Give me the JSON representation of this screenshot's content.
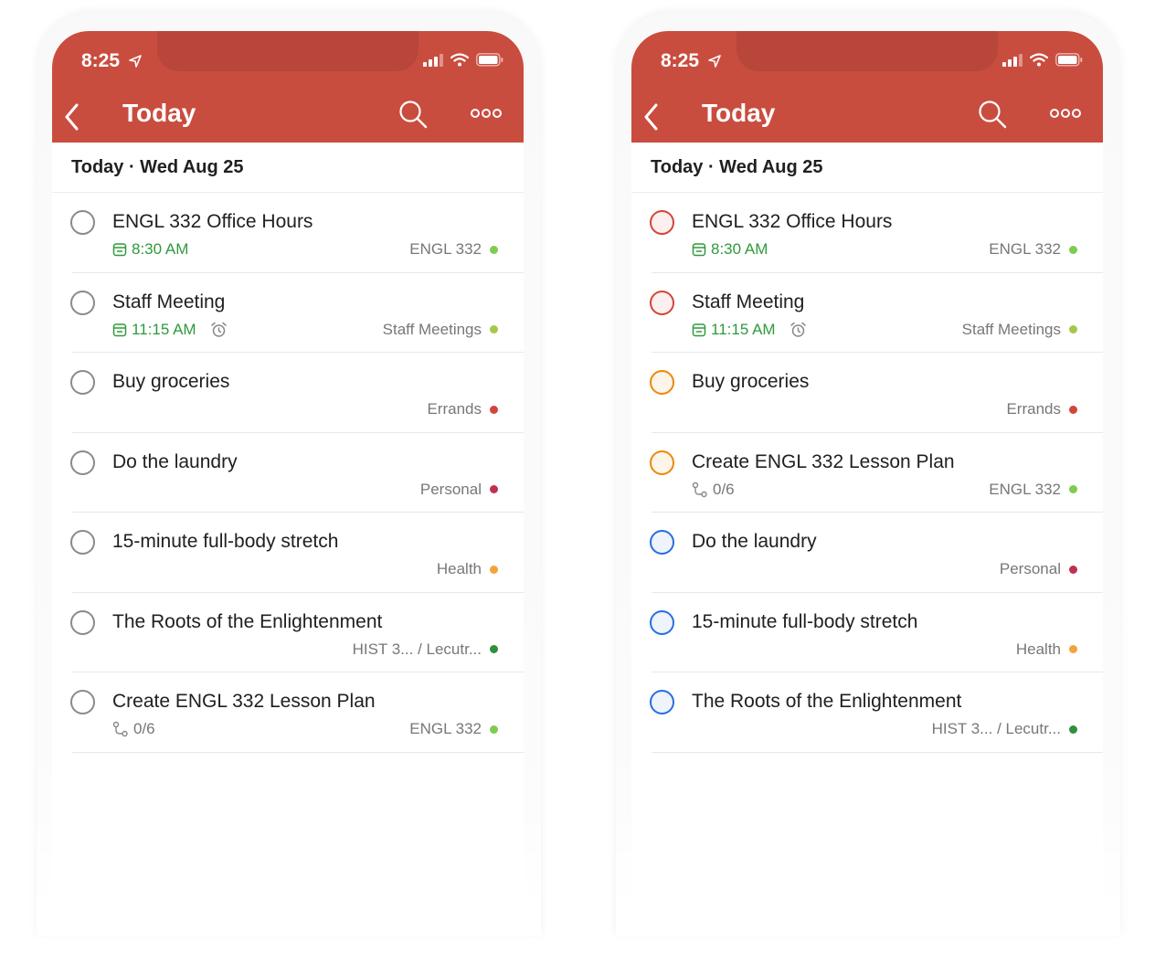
{
  "phones": [
    {
      "status_time": "8:25",
      "title": "Today",
      "date_label": "Today · Wed Aug 25",
      "tasks": [
        {
          "title": "ENGL 332 Office Hours",
          "meta_kind": "date",
          "meta": "8:30 AM",
          "alarm": false,
          "project": "ENGL 332",
          "project_color": "#7ecb4e",
          "check_color": "#8a8a8a",
          "check_fill": "#ffffff"
        },
        {
          "title": "Staff Meeting",
          "meta_kind": "date",
          "meta": "11:15 AM",
          "alarm": true,
          "project": "Staff Meetings",
          "project_color": "#a6c84a",
          "check_color": "#8a8a8a",
          "check_fill": "#ffffff"
        },
        {
          "title": "Buy groceries",
          "meta_kind": "none",
          "meta": "",
          "alarm": false,
          "project": "Errands",
          "project_color": "#d2453b",
          "check_color": "#8a8a8a",
          "check_fill": "#ffffff"
        },
        {
          "title": "Do the laundry",
          "meta_kind": "none",
          "meta": "",
          "alarm": false,
          "project": "Personal",
          "project_color": "#c0314f",
          "check_color": "#8a8a8a",
          "check_fill": "#ffffff"
        },
        {
          "title": "15-minute full-body stretch",
          "meta_kind": "none",
          "meta": "",
          "alarm": false,
          "project": "Health",
          "project_color": "#f2a33c",
          "check_color": "#8a8a8a",
          "check_fill": "#ffffff"
        },
        {
          "title": "The Roots of the Enlightenment",
          "meta_kind": "none",
          "meta": "",
          "alarm": false,
          "project": "HIST 3... / Lecutr...",
          "project_color": "#2f8f3a",
          "check_color": "#8a8a8a",
          "check_fill": "#ffffff"
        },
        {
          "title": "Create ENGL 332 Lesson Plan",
          "meta_kind": "subtask",
          "meta": "0/6",
          "alarm": false,
          "project": "ENGL 332",
          "project_color": "#7ecb4e",
          "check_color": "#8a8a8a",
          "check_fill": "#ffffff"
        }
      ]
    },
    {
      "status_time": "8:25",
      "title": "Today",
      "date_label": "Today · Wed Aug 25",
      "tasks": [
        {
          "title": "ENGL 332 Office Hours",
          "meta_kind": "date",
          "meta": "8:30 AM",
          "alarm": false,
          "project": "ENGL 332",
          "project_color": "#7ecb4e",
          "check_color": "#d1453b",
          "check_fill": "#fcefed"
        },
        {
          "title": "Staff Meeting",
          "meta_kind": "date",
          "meta": "11:15 AM",
          "alarm": true,
          "project": "Staff Meetings",
          "project_color": "#a6c84a",
          "check_color": "#d1453b",
          "check_fill": "#fcefed"
        },
        {
          "title": "Buy groceries",
          "meta_kind": "none",
          "meta": "",
          "alarm": false,
          "project": "Errands",
          "project_color": "#d2453b",
          "check_color": "#eb8909",
          "check_fill": "#fdf4ea"
        },
        {
          "title": "Create ENGL 332 Lesson Plan",
          "meta_kind": "subtask",
          "meta": "0/6",
          "alarm": false,
          "project": "ENGL 332",
          "project_color": "#7ecb4e",
          "check_color": "#eb8909",
          "check_fill": "#fdf4ea"
        },
        {
          "title": "Do the laundry",
          "meta_kind": "none",
          "meta": "",
          "alarm": false,
          "project": "Personal",
          "project_color": "#c0314f",
          "check_color": "#246fe0",
          "check_fill": "#eef3fc"
        },
        {
          "title": "15-minute full-body stretch",
          "meta_kind": "none",
          "meta": "",
          "alarm": false,
          "project": "Health",
          "project_color": "#f2a33c",
          "check_color": "#246fe0",
          "check_fill": "#eef3fc"
        },
        {
          "title": "The Roots of the Enlightenment",
          "meta_kind": "none",
          "meta": "",
          "alarm": false,
          "project": "HIST 3... / Lecutr...",
          "project_color": "#2f8f3a",
          "check_color": "#246fe0",
          "check_fill": "#eef3fc"
        }
      ]
    }
  ]
}
